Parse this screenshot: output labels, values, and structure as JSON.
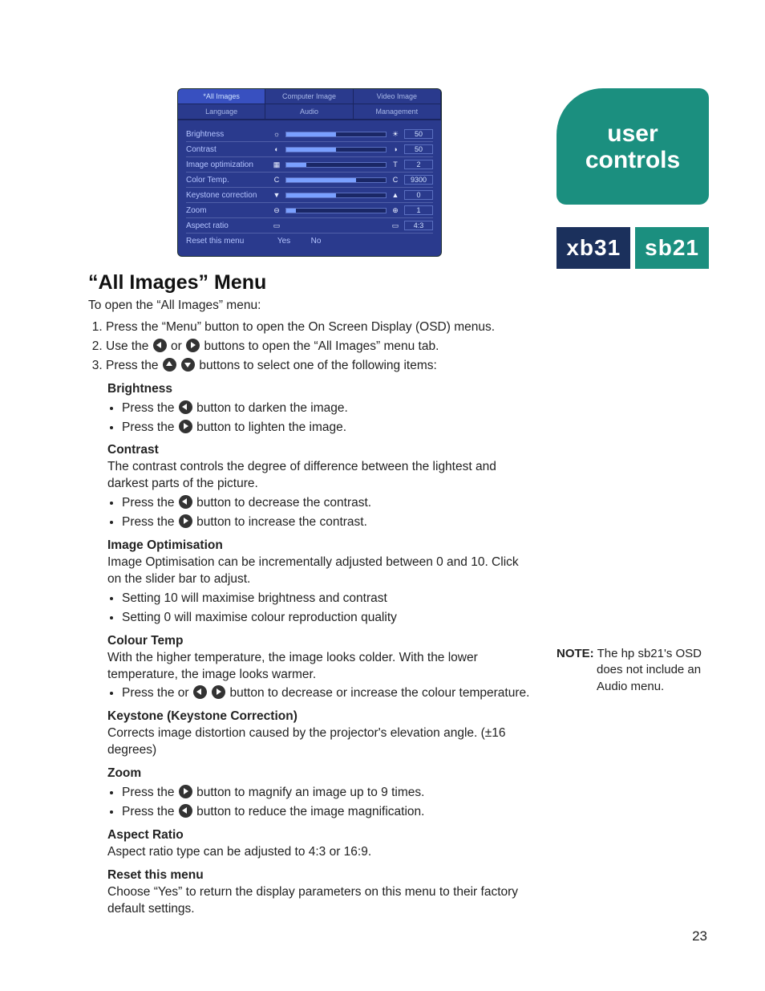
{
  "osd": {
    "tabs_row1": [
      "*All Images",
      "Computer Image",
      "Video Image"
    ],
    "tabs_row2": [
      "Language",
      "Audio",
      "Management"
    ],
    "rows": [
      {
        "label": "Brightness",
        "iconL": "☼",
        "iconR": "☀",
        "val": "50",
        "pct": 50
      },
      {
        "label": "Contrast",
        "iconL": "◐",
        "iconR": "◑",
        "val": "50",
        "pct": 50
      },
      {
        "label": "Image optimization",
        "iconL": "▦",
        "iconR": "T",
        "val": "2",
        "pct": 20
      },
      {
        "label": "Color Temp.",
        "iconL": "C",
        "iconR": "C",
        "val": "9300",
        "pct": 70
      },
      {
        "label": "Keystone correction",
        "iconL": "▼",
        "iconR": "▲",
        "val": "0",
        "pct": 50
      },
      {
        "label": "Zoom",
        "iconL": "⊖",
        "iconR": "⊕",
        "val": "1",
        "pct": 10
      },
      {
        "label": "Aspect ratio",
        "iconL": "▭",
        "iconR": "▭",
        "val": "4:3",
        "pct": 0
      }
    ],
    "reset": {
      "label": "Reset this menu",
      "yes": "Yes",
      "no": "No"
    }
  },
  "heading": "“All Images” Menu",
  "intro": "To open the “All Images” menu:",
  "steps": {
    "s1": "Press the “Menu” button to open the On Screen Display (OSD) menus.",
    "s2a": "Use the ",
    "s2b": " or ",
    "s2c": " buttons to open the “All Images” menu tab.",
    "s3a": "Press the ",
    "s3b": " buttons to select one of the following items:"
  },
  "sections": {
    "brightness": {
      "title": "Brightness",
      "b1a": "Press the ",
      "b1b": " button to darken the image.",
      "b2a": "Press the ",
      "b2b": " button to lighten the image."
    },
    "contrast": {
      "title": "Contrast",
      "desc": "The contrast controls the degree of difference between the lightest and darkest parts of the picture.",
      "b1a": "Press the ",
      "b1b": " button to decrease the contrast.",
      "b2a": "Press the ",
      "b2b": " button to increase the contrast."
    },
    "imgopt": {
      "title": "Image Optimisation",
      "desc": "Image Optimisation can be incrementally adjusted between 0 and 10. Click on the slider bar to adjust.",
      "b1": "Setting 10 will maximise brightness and contrast",
      "b2": "Setting 0 will maximise colour reproduction quality"
    },
    "ctemp": {
      "title": "Colour Temp",
      "desc": "With the higher temperature, the image looks colder.  With the lower temperature, the image looks warmer.",
      "b1a": "Press the or ",
      "b1b": " button to decrease or increase the colour temperature."
    },
    "keystone": {
      "title": "Keystone (Keystone Correction)",
      "desc": "Corrects image distortion caused by the projector's elevation angle. (±16 degrees)"
    },
    "zoom": {
      "title": "Zoom",
      "b1a": "Press the ",
      "b1b": " button to magnify an image up to 9 times.",
      "b2a": "Press the ",
      "b2b": " button to reduce the image magnification."
    },
    "aspect": {
      "title": "Aspect Ratio",
      "desc": "Aspect ratio type can be adjusted to 4:3 or 16:9."
    },
    "reset": {
      "title": "Reset this menu",
      "desc": "Choose “Yes” to return the display parameters on this menu to their factory default settings."
    }
  },
  "sidebar": {
    "badge_l1": "user",
    "badge_l2": "controls",
    "model1": "xb31",
    "model2": "sb21",
    "note_label": "NOTE:",
    "note_text1": "The hp sb21's OSD",
    "note_text2": "does not include an",
    "note_text3": "Audio menu."
  },
  "page_number": "23"
}
